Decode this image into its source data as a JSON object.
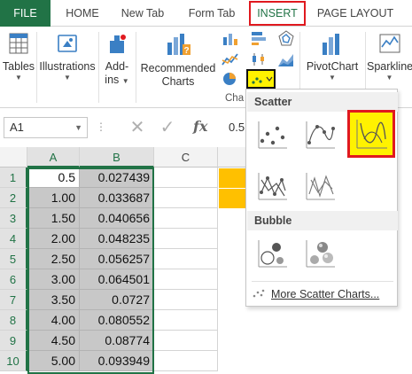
{
  "tabs": [
    "FILE",
    "HOME",
    "New Tab",
    "Form Tab",
    "INSERT",
    "PAGE LAYOUT"
  ],
  "ribbon": {
    "tables": "Tables",
    "illustrations": "Illustrations",
    "addins_1": "Add-",
    "addins_2": "ins",
    "recommended_1": "Recommended",
    "recommended_2": "Charts",
    "charts_group": "Cha",
    "pivotchart": "PivotChart",
    "sparklines": "Sparklines"
  },
  "formula_bar": {
    "name_box": "A1",
    "fx": "fx",
    "value": "0.5"
  },
  "grid": {
    "columns": [
      "A",
      "B",
      "C"
    ],
    "rows": [
      {
        "n": "1",
        "a": "0.5",
        "b": "0.027439"
      },
      {
        "n": "2",
        "a": "1.00",
        "b": "0.033687"
      },
      {
        "n": "3",
        "a": "1.50",
        "b": "0.040656"
      },
      {
        "n": "4",
        "a": "2.00",
        "b": "0.048235"
      },
      {
        "n": "5",
        "a": "2.50",
        "b": "0.056257"
      },
      {
        "n": "6",
        "a": "3.00",
        "b": "0.064501"
      },
      {
        "n": "7",
        "a": "3.50",
        "b": "0.0727"
      },
      {
        "n": "8",
        "a": "4.00",
        "b": "0.080552"
      },
      {
        "n": "9",
        "a": "4.50",
        "b": "0.08774"
      },
      {
        "n": "10",
        "a": "5.00",
        "b": "0.093949"
      }
    ]
  },
  "dropdown": {
    "scatter_header": "Scatter",
    "bubble_header": "Bubble",
    "more": "More Scatter Charts..."
  },
  "colors": {
    "excel_green": "#217346",
    "highlight_red": "#e0191f",
    "highlight_yellow": "#fff200",
    "orange_fill": "#ffc000"
  }
}
